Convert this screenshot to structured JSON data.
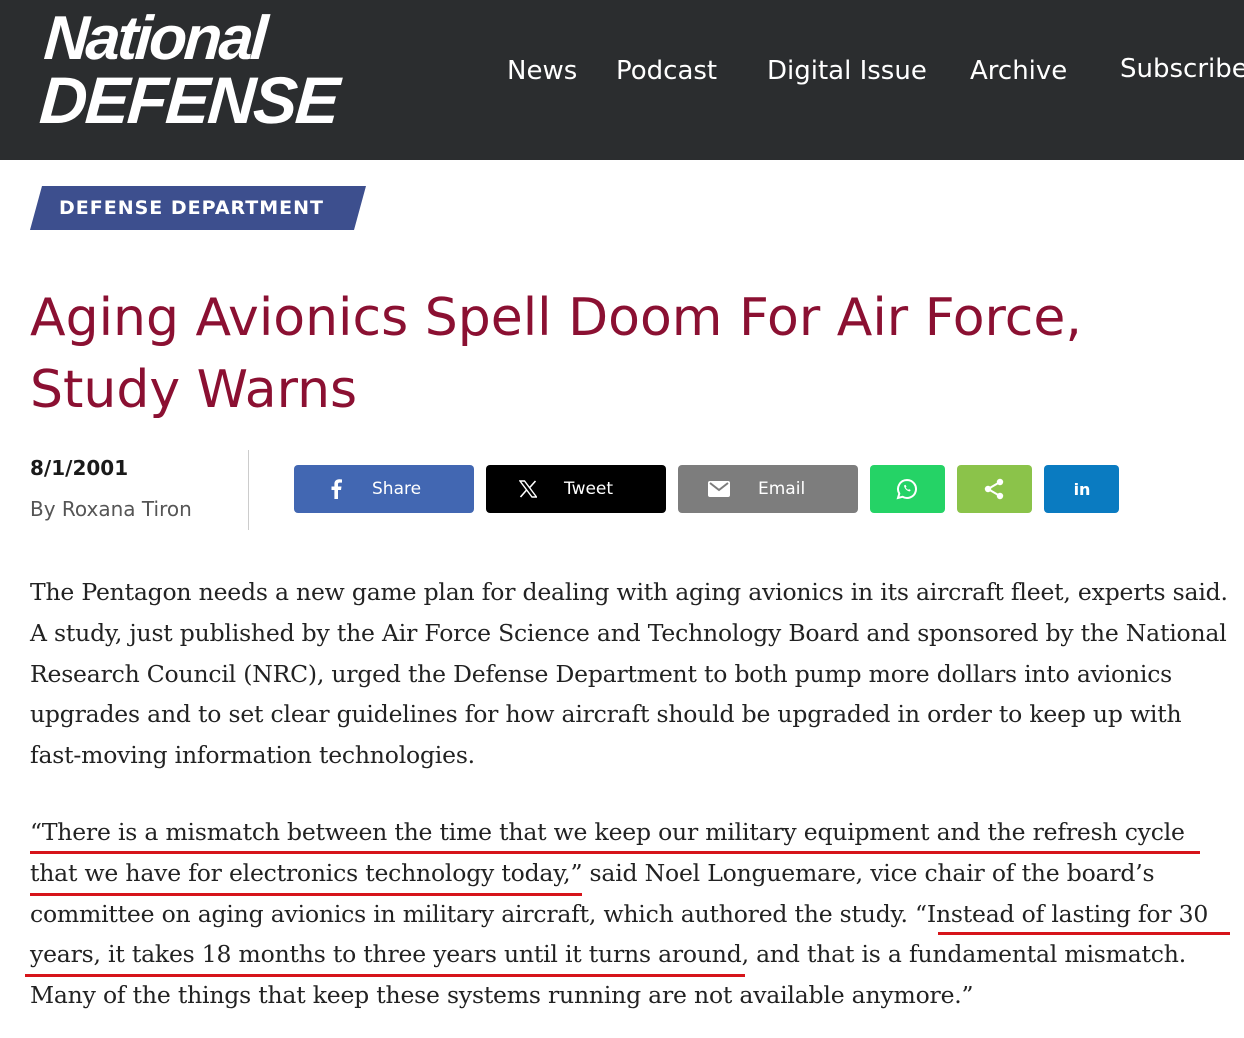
{
  "site": {
    "logo_line1": "National",
    "logo_line2": "DEFENSE",
    "nav": [
      "News",
      "Podcast",
      "Digital Issue",
      "Archive",
      "Subscribe"
    ]
  },
  "article": {
    "category": "DEFENSE DEPARTMENT",
    "title": "Aging Avionics Spell Doom For Air Force, Study Warns",
    "date": "8/1/2001",
    "author": "By Roxana Tiron",
    "paragraph1": "The Pentagon needs a new game plan for dealing with aging avionics in its aircraft fleet, experts said. A study, just published by the Air Force Science and Technology Board and sponsored by the National Research Council (NRC), urged the Defense Department to both pump more dollars into avionics upgrades and to set clear guidelines for how aircraft should be upgraded in order to keep up with fast-moving information technologies.",
    "paragraph2": "“There is a mismatch between the time that we keep our military equipment and the refresh cycle that we have for electronics technology today,” said Noel Longuemare, vice chair of the board’s committee on aging avionics in military aircraft, which authored the study. “Instead of lasting for 30 years, it takes 18 months to three years until it turns around, and that is a fundamental mismatch. Many of the things that keep these systems running are not available anymore.”"
  },
  "share": {
    "facebook": "Share",
    "x": "Tweet",
    "email": "Email",
    "linkedin": "in"
  },
  "colors": {
    "header_bg": "#2b2d2f",
    "category_bg": "#3d4f8e",
    "title": "#8b1032",
    "facebook": "#4267b2",
    "x": "#000000",
    "email": "#7d7d7d",
    "whatsapp": "#25d366",
    "sharethis": "#8bc34a",
    "linkedin": "#0a7bc1",
    "annotation": "#d6141a"
  },
  "icons": [
    "facebook-icon",
    "x-icon",
    "email-icon",
    "whatsapp-icon",
    "share-icon",
    "linkedin-icon"
  ]
}
